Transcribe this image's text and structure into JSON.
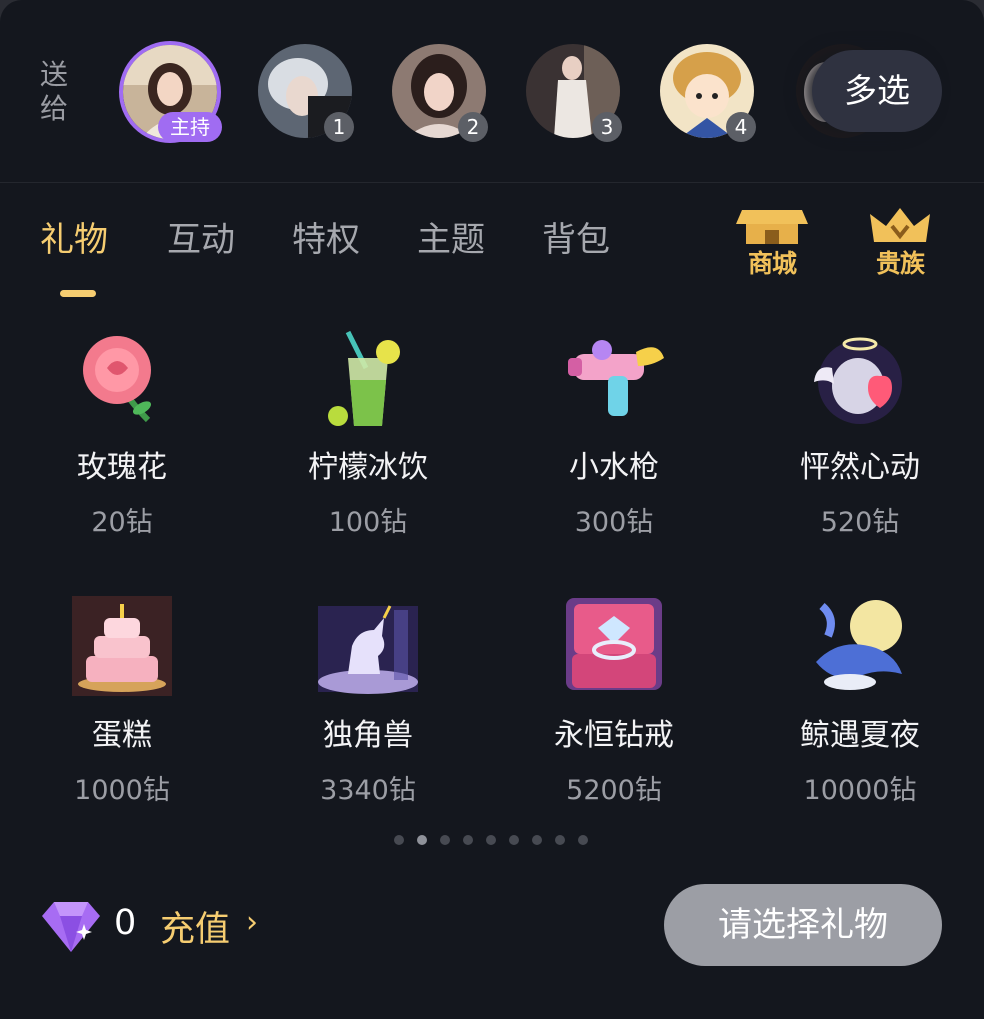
{
  "send_to": {
    "label": "送给"
  },
  "recipients": [
    {
      "role": "host",
      "tag": "主持"
    },
    {
      "role": "guest",
      "number": "1"
    },
    {
      "role": "guest",
      "number": "2"
    },
    {
      "role": "guest",
      "number": "3"
    },
    {
      "role": "guest",
      "number": "4"
    },
    {
      "role": "guest",
      "number": ""
    }
  ],
  "multi_select": {
    "label": "多选"
  },
  "tabs": [
    {
      "label": "礼物",
      "active": true
    },
    {
      "label": "互动",
      "active": false
    },
    {
      "label": "特权",
      "active": false
    },
    {
      "label": "主题",
      "active": false
    },
    {
      "label": "背包",
      "active": false
    }
  ],
  "shortcuts": {
    "shop": {
      "label": "商城",
      "icon": "shop-icon"
    },
    "noble": {
      "label": "贵族",
      "icon": "crown-icon"
    }
  },
  "gifts": [
    {
      "name": "玫瑰花",
      "price": "20钻",
      "icon": "rose-icon"
    },
    {
      "name": "柠檬冰饮",
      "price": "100钻",
      "icon": "lemon-drink-icon"
    },
    {
      "name": "小水枪",
      "price": "300钻",
      "icon": "water-gun-icon"
    },
    {
      "name": "怦然心动",
      "price": "520钻",
      "icon": "heart-angel-icon"
    },
    {
      "name": "蛋糕",
      "price": "1000钻",
      "icon": "cake-icon"
    },
    {
      "name": "独角兽",
      "price": "3340钻",
      "icon": "unicorn-icon"
    },
    {
      "name": "永恒钻戒",
      "price": "5200钻",
      "icon": "diamond-ring-icon"
    },
    {
      "name": "鲸遇夏夜",
      "price": "10000钻",
      "icon": "whale-moon-icon"
    }
  ],
  "pagination": {
    "total": 9,
    "current": 2
  },
  "wallet": {
    "balance": "0",
    "recharge_label": "充值",
    "arrow": "›",
    "icon": "diamond-icon"
  },
  "send_button": {
    "label": "请选择礼物"
  },
  "colors": {
    "accent": "#f6cd71",
    "host_purple": "#a06cf2",
    "background": "#14171e"
  }
}
